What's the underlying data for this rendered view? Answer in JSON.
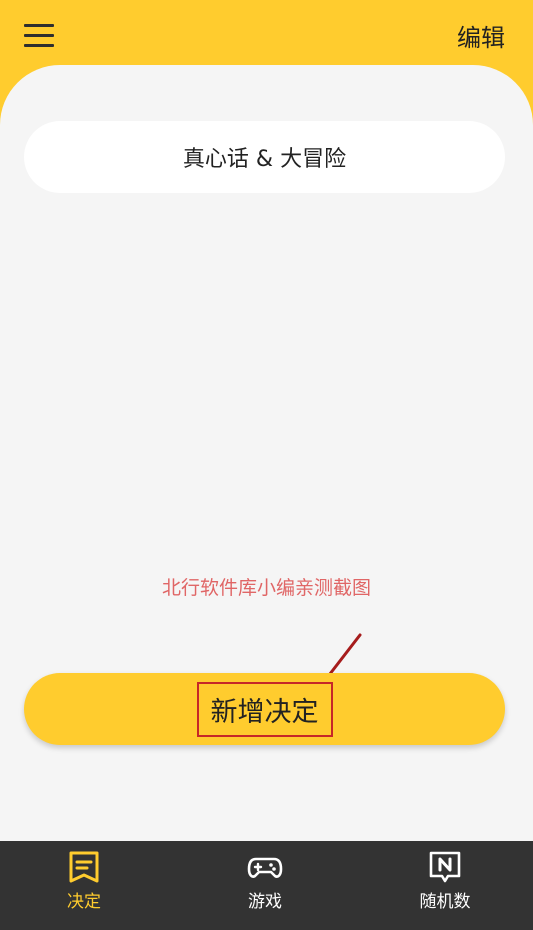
{
  "header": {
    "menu_icon": "hamburger-menu-icon",
    "edit_label": "编辑"
  },
  "decisions": [
    {
      "title": "真心话 & 大冒险"
    }
  ],
  "annotation": "北行软件库小编亲测截图",
  "add_button_label": "新增决定",
  "tabbar": {
    "tabs": [
      {
        "label": "决定",
        "icon": "decision-tab-icon",
        "active": true
      },
      {
        "label": "游戏",
        "icon": "gamepad-icon",
        "active": false
      },
      {
        "label": "随机数",
        "icon": "random-number-icon",
        "active": false
      }
    ]
  },
  "colors": {
    "accent": "#FFCC2E",
    "background": "#F5F5F5",
    "tabbar": "#333333",
    "annotation": "#E06666",
    "highlight_box": "#C62828"
  }
}
